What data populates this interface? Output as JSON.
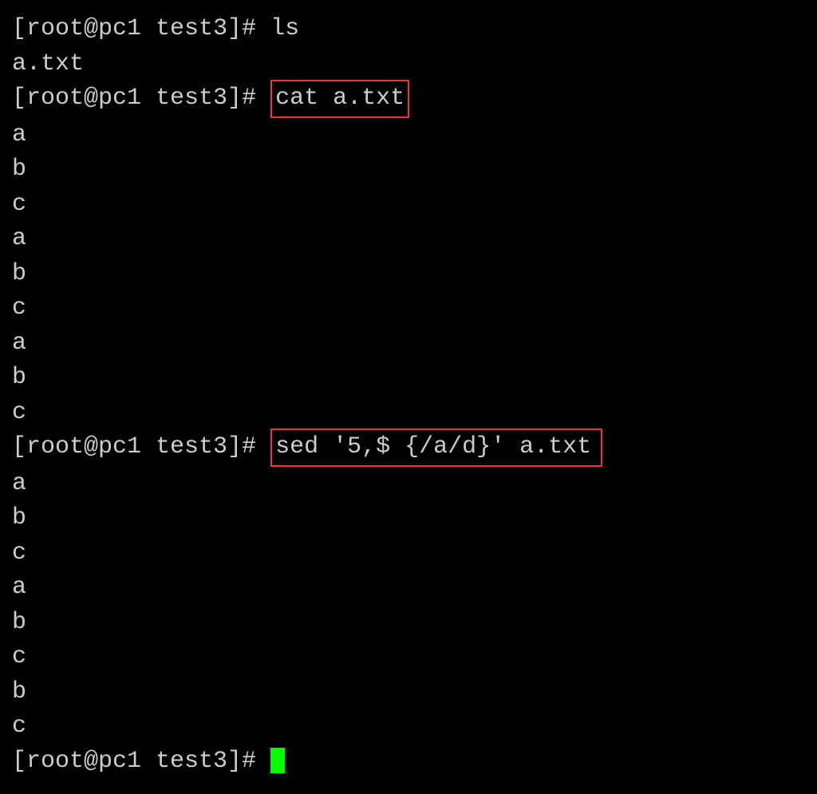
{
  "terminal": {
    "lines": [
      {
        "prompt": "[root@pc1 test3]# ",
        "command": "ls",
        "highlighted": false
      },
      {
        "output": "a.txt"
      },
      {
        "prompt": "[root@pc1 test3]# ",
        "command": "cat a.txt",
        "highlighted": true,
        "wide": false
      },
      {
        "output": "a"
      },
      {
        "output": "b"
      },
      {
        "output": "c"
      },
      {
        "output": "a"
      },
      {
        "output": "b"
      },
      {
        "output": "c"
      },
      {
        "output": "a"
      },
      {
        "output": "b"
      },
      {
        "output": "c"
      },
      {
        "prompt": "[root@pc1 test3]# ",
        "command": "sed '5,$ {/a/d}' a.txt",
        "highlighted": true,
        "wide": true
      },
      {
        "output": "a"
      },
      {
        "output": "b"
      },
      {
        "output": "c"
      },
      {
        "output": "a"
      },
      {
        "output": "b"
      },
      {
        "output": "c"
      },
      {
        "output": "b"
      },
      {
        "output": "c"
      },
      {
        "prompt": "[root@pc1 test3]# ",
        "cursor": true
      }
    ]
  }
}
